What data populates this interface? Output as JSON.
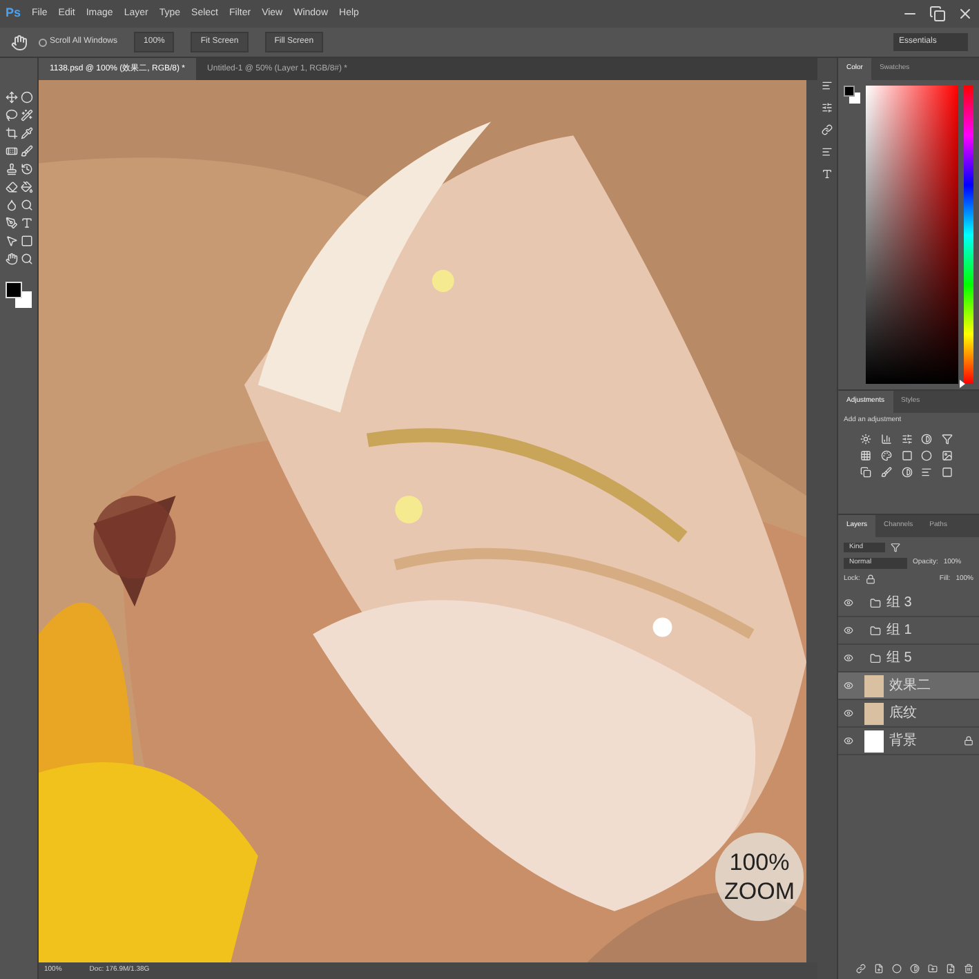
{
  "app_logo": "Ps",
  "hue_slider": {
    "level": 0.0
  },
  "menu": [
    "File",
    "Edit",
    "Image",
    "Layer",
    "Type",
    "Select",
    "Filter",
    "View",
    "Window",
    "Help"
  ],
  "options_bar": {
    "scroll_all_windows": {
      "label": "Scroll All Windows",
      "checked": false
    },
    "buttons": [
      "100%",
      "Fit Screen",
      "Fill Screen"
    ],
    "workspace": "Essentials"
  },
  "document_tabs": [
    {
      "title": "1138.psd @ 100% (效果二, RGB/8) *",
      "selected": true
    },
    {
      "title": "Untitled-1 @ 50% (Layer 1, RGB/8#) *",
      "selected": false
    }
  ],
  "zoom_badge": [
    "100%",
    "ZOOM"
  ],
  "color_panel": {
    "tabs": [
      {
        "label": "Color",
        "selected": true
      },
      {
        "label": "Swatches",
        "selected": false
      }
    ]
  },
  "adjustments_panel": {
    "tabs": [
      {
        "label": "Adjustments",
        "selected": true
      },
      {
        "label": "Styles",
        "selected": false
      }
    ],
    "hint": "Add an adjustment"
  },
  "layers_panel": {
    "tabs": [
      {
        "label": "Layers",
        "selected": true
      },
      {
        "label": "Channels",
        "selected": false
      },
      {
        "label": "Paths",
        "selected": false
      }
    ],
    "filter": "Kind",
    "blend_mode": "Normal",
    "opacity_label": "Opacity:",
    "opacity": "100%",
    "lock_label": "Lock:",
    "fill_label": "Fill:",
    "fill": "100%",
    "layers": [
      {
        "kind": "group",
        "name": "组 3",
        "selected": false
      },
      {
        "kind": "group",
        "name": "组 1",
        "selected": false
      },
      {
        "kind": "group",
        "name": "组 5",
        "selected": false
      },
      {
        "name": "效果二",
        "selected": true
      },
      {
        "name": "底纹",
        "selected": false
      },
      {
        "kind": "background",
        "name": "背景",
        "selected": false
      }
    ]
  },
  "status_bar": {
    "zoom": "100%",
    "doc": "Doc: 176.9M/1.38G"
  }
}
